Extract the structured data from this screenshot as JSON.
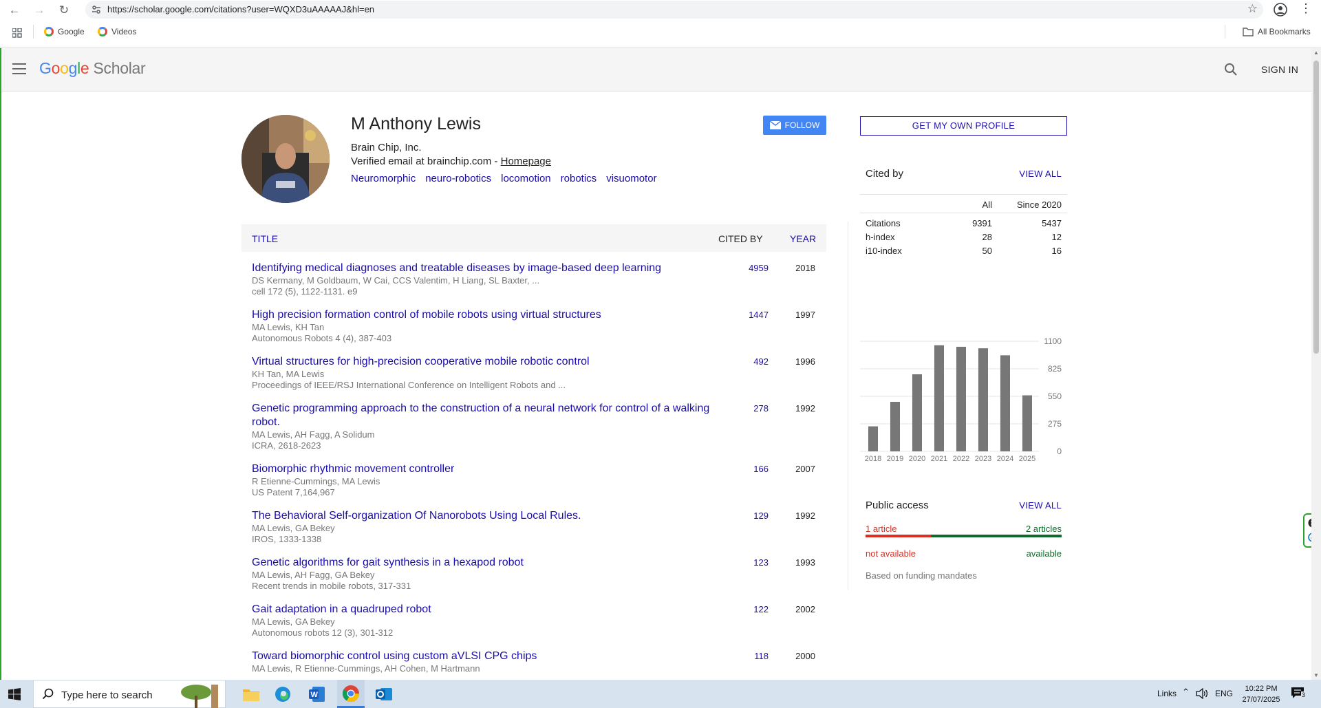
{
  "browser": {
    "url": "https://scholar.google.com/citations?user=WQXD3uAAAAAJ&hl=en",
    "bookmarks": [
      "Google",
      "Videos"
    ],
    "all_bookmarks": "All Bookmarks"
  },
  "header": {
    "logo_google": "Google",
    "logo_scholar": "Scholar",
    "sign_in": "SIGN IN"
  },
  "profile": {
    "name": "M Anthony Lewis",
    "affiliation": "Brain Chip, Inc.",
    "verified": "Verified email at brainchip.com - ",
    "homepage": "Homepage",
    "interests": [
      "Neuromorphic",
      "neuro-robotics",
      "locomotion",
      "robotics",
      "visuomotor"
    ],
    "follow": "FOLLOW",
    "get_profile": "GET MY OWN PROFILE"
  },
  "table": {
    "headers": {
      "title": "TITLE",
      "cited_by": "CITED BY",
      "year": "YEAR"
    },
    "rows": [
      {
        "title": "Identifying medical diagnoses and treatable diseases by image-based deep learning",
        "authors": "DS Kermany, M Goldbaum, W Cai, CCS Valentim, H Liang, SL Baxter, ...",
        "venue": "cell 172 (5), 1122-1131. e9",
        "cited": "4959",
        "year": "2018"
      },
      {
        "title": "High precision formation control of mobile robots using virtual structures",
        "authors": "MA Lewis, KH Tan",
        "venue": "Autonomous Robots 4 (4), 387-403",
        "cited": "1447",
        "year": "1997"
      },
      {
        "title": "Virtual structures for high-precision cooperative mobile robotic control",
        "authors": "KH Tan, MA Lewis",
        "venue": "Proceedings of IEEE/RSJ International Conference on Intelligent Robots and ...",
        "cited": "492",
        "year": "1996"
      },
      {
        "title": "Genetic programming approach to the construction of a neural network for control of a walking robot.",
        "authors": "MA Lewis, AH Fagg, A Solidum",
        "venue": "ICRA, 2618-2623",
        "cited": "278",
        "year": "1992"
      },
      {
        "title": "Biomorphic rhythmic movement controller",
        "authors": "R Etienne-Cummings, MA Lewis",
        "venue": "US Patent 7,164,967",
        "cited": "166",
        "year": "2007"
      },
      {
        "title": "The Behavioral Self-organization Of Nanorobots Using Local Rules.",
        "authors": "MA Lewis, GA Bekey",
        "venue": "IROS, 1333-1338",
        "cited": "129",
        "year": "1992"
      },
      {
        "title": "Genetic algorithms for gait synthesis in a hexapod robot",
        "authors": "MA Lewis, AH Fagg, GA Bekey",
        "venue": "Recent trends in mobile robots, 317-331",
        "cited": "123",
        "year": "1993"
      },
      {
        "title": "Gait adaptation in a quadruped robot",
        "authors": "MA Lewis, GA Bekey",
        "venue": "Autonomous robots 12 (3), 301-312",
        "cited": "122",
        "year": "2002"
      },
      {
        "title": "Toward biomorphic control using custom aVLSI CPG chips",
        "authors": "MA Lewis, R Etienne-Cummings, AH Cohen, M Hartmann",
        "venue": "",
        "cited": "118",
        "year": "2000"
      }
    ]
  },
  "cited_by": {
    "title": "Cited by",
    "view_all": "VIEW ALL",
    "col_all": "All",
    "col_since": "Since 2020",
    "stats": [
      {
        "label": "Citations",
        "all": "9391",
        "since": "5437"
      },
      {
        "label": "h-index",
        "all": "28",
        "since": "12"
      },
      {
        "label": "i10-index",
        "all": "50",
        "since": "16"
      }
    ]
  },
  "chart_data": {
    "type": "bar",
    "categories": [
      "2018",
      "2019",
      "2020",
      "2021",
      "2022",
      "2023",
      "2024",
      "2025"
    ],
    "values": [
      250,
      495,
      770,
      1060,
      1045,
      1030,
      960,
      560
    ],
    "ylim": [
      0,
      1100
    ],
    "yticks": [
      "1100",
      "825",
      "550",
      "275",
      "0"
    ],
    "ytick_values": [
      1100,
      825,
      550,
      275,
      0
    ],
    "bar_color": "#777777"
  },
  "public_access": {
    "title": "Public access",
    "view_all": "VIEW ALL",
    "left_count": "1 article",
    "right_count": "2 articles",
    "left_label": "not available",
    "right_label": "available",
    "note": "Based on funding mandates",
    "available_fraction": 0.333
  },
  "taskbar": {
    "search_placeholder": "Type here to search",
    "links": "Links",
    "lang": "ENG",
    "time": "10:22 PM",
    "date": "27/07/2025",
    "notifications": "3"
  }
}
